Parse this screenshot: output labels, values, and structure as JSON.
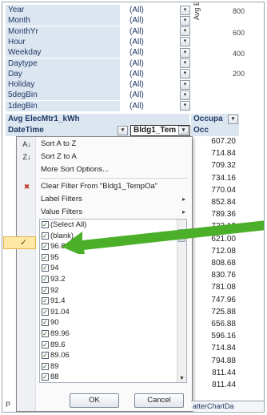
{
  "filters": [
    {
      "name": "Year",
      "value": "(All)"
    },
    {
      "name": "Month",
      "value": "(All)"
    },
    {
      "name": "MonthYr",
      "value": "(All)"
    },
    {
      "name": "Hour",
      "value": "(All)"
    },
    {
      "name": "Weekday",
      "value": "(All)"
    },
    {
      "name": "Daytype",
      "value": "(All)"
    },
    {
      "name": "Day",
      "value": "(All)"
    },
    {
      "name": "Holiday",
      "value": "(All)"
    },
    {
      "name": "5degBin",
      "value": "(All)"
    },
    {
      "name": "1degBin",
      "value": "(All)"
    }
  ],
  "chart": {
    "axis_title": "Avg El",
    "ticks": [
      "800",
      "600",
      "400",
      "200"
    ]
  },
  "pivot": {
    "data_field": "Avg ElecMtr1_kWh",
    "row_field": "DateTime",
    "column_field": "Bldg1_Tem",
    "occupancy_header": "Occupa",
    "occ_header": "Occ",
    "values": [
      "607.20",
      "714.84",
      "709.32",
      "734.16",
      "770.04",
      "852.84",
      "789.36",
      "723.12",
      "621.00",
      "712.08",
      "808.68",
      "830.76",
      "781.08",
      "747.96",
      "725.88",
      "656.88",
      "596.16",
      "714.84",
      "794.88",
      "811.44",
      "811.44"
    ]
  },
  "menu": {
    "sort_az": "Sort A to Z",
    "sort_za": "Sort Z to A",
    "more_sort": "More Sort Options...",
    "clear_filter": "Clear Filter From \"Bldg1_TempOa\"",
    "label_filters": "Label Filters",
    "value_filters": "Value Filters",
    "list_items": [
      "(Select All)",
      "(blank)",
      "96.8",
      "95",
      "94",
      "93.2",
      "92",
      "91.4",
      "91.04",
      "90",
      "89.96",
      "89.6",
      "89.06",
      "89",
      "88"
    ],
    "ok": "OK",
    "cancel": "Cancel"
  },
  "tabs": {
    "left": "P",
    "right": "atterChartDa"
  },
  "colors": {
    "header_fill": "#dce6f1",
    "arrow": "#4caf2a",
    "check_highlight": "#ffe8a6"
  }
}
